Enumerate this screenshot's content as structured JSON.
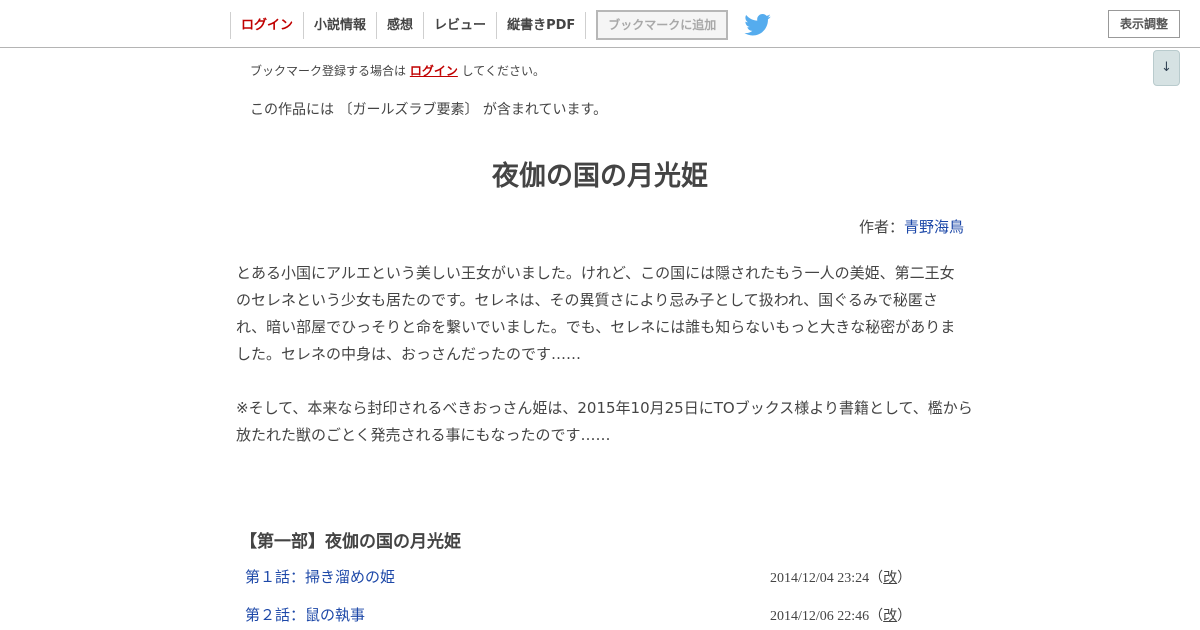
{
  "header": {
    "nav": {
      "login": "ログイン",
      "info": "小説情報",
      "impressions": "感想",
      "review": "レビュー",
      "pdf": "縦書きPDF"
    },
    "bookmark_button": "ブックマークに追加",
    "display_button": "表示調整",
    "scroll_button": "↓",
    "twitter_icon": "twitter-bird"
  },
  "notice": {
    "before": "ブックマーク登録する場合は ",
    "login_link": "ログイン",
    "after": " してください。"
  },
  "tag_note": "この作品には 〔ガールズラブ要素〕 が含まれています。",
  "novel": {
    "title": "夜伽の国の月光姫",
    "author_label": "作者：",
    "author_name": "青野海鳥"
  },
  "synopsis": {
    "lines": [
      "とある小国にアルエという美しい王女がいました。けれど、この国には隠されたもう一人の美姫、第二王女",
      "のセレネという少女も居たのです。セレネは、その異質さにより忌み子として扱われ、国ぐるみで秘匿さ",
      "れ、暗い部屋でひっそりと命を繋いでいました。でも、セレネには誰も知らないもっと大きな秘密がありま",
      "した。セレネの中身は、おっさんだったのです……",
      "",
      "※そして、本来なら封印されるべきおっさん姫は、2015年10月25日にTOブックス様より書籍として、檻から",
      "放たれた獣のごとく発売される事にもなったのです……"
    ]
  },
  "chapter": {
    "title": "【第一部】夜伽の国の月光姫",
    "episodes": [
      {
        "title": "第１話：掃き溜めの姫",
        "date": "2014/12/04 23:24",
        "rev_open": "（",
        "rev": "改",
        "rev_close": "）"
      },
      {
        "title": "第２話：鼠の執事",
        "date": "2014/12/06 22:46",
        "rev_open": "（",
        "rev": "改",
        "rev_close": "）"
      }
    ]
  },
  "colors": {
    "login_red": "#c00000",
    "link_blue": "#1d48a8",
    "twitter_blue": "#55acee"
  }
}
